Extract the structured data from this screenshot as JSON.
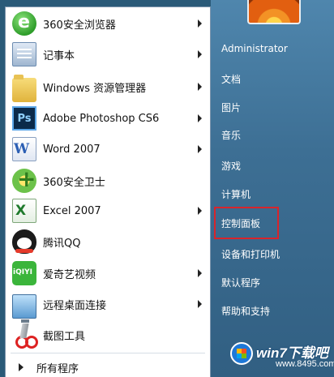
{
  "programs": [
    {
      "label": "360安全浏览器",
      "icon": "360-browser-icon",
      "has_arrow": true
    },
    {
      "label": "记事本",
      "icon": "notepad-icon",
      "has_arrow": true
    },
    {
      "label": "Windows 资源管理器",
      "icon": "folder-icon",
      "has_arrow": true
    },
    {
      "label": "Adobe Photoshop CS6",
      "icon": "photoshop-icon",
      "has_arrow": true
    },
    {
      "label": "Word 2007",
      "icon": "word-icon",
      "has_arrow": true
    },
    {
      "label": "360安全卫士",
      "icon": "360-safe-icon",
      "has_arrow": false
    },
    {
      "label": "Excel 2007",
      "icon": "excel-icon",
      "has_arrow": true
    },
    {
      "label": "腾讯QQ",
      "icon": "qq-icon",
      "has_arrow": false
    },
    {
      "label": "爱奇艺视频",
      "icon": "iqiyi-icon",
      "has_arrow": true
    },
    {
      "label": "远程桌面连接",
      "icon": "remote-desktop-icon",
      "has_arrow": true
    },
    {
      "label": "截图工具",
      "icon": "snipping-tool-icon",
      "has_arrow": false
    }
  ],
  "ps_icon_text": "Ps",
  "all_programs": "所有程序",
  "right_items": [
    "Administrator",
    "文档",
    "图片",
    "音乐",
    "游戏",
    "计算机",
    "控制面板",
    "设备和打印机",
    "默认程序",
    "帮助和支持"
  ],
  "highlighted_item": "控制面板",
  "highlight_color": "#d8242b",
  "watermark": {
    "brand": "win7下载吧",
    "url": "www.8495.com"
  }
}
